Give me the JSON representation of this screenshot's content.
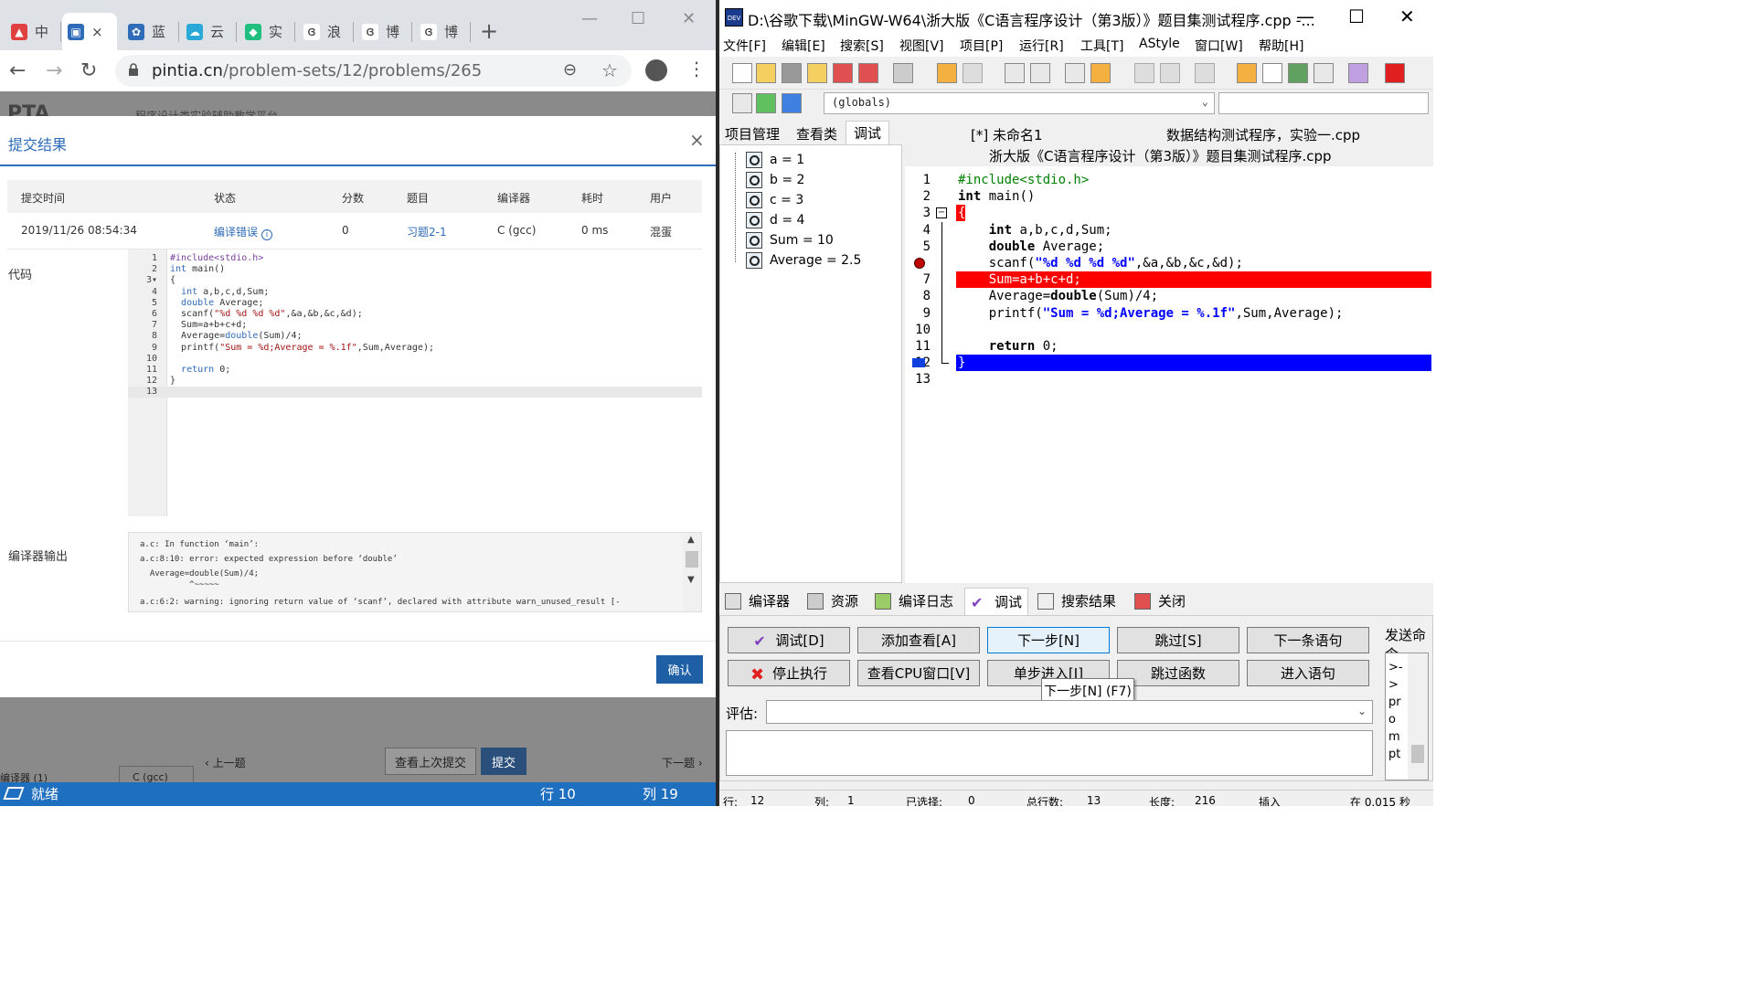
{
  "browser": {
    "tabs": [
      {
        "label": "中",
        "color": "#e04040"
      },
      {
        "label": "×",
        "color": "#2e6bb8"
      },
      {
        "label": "蓝",
        "color": "#2e6bb8"
      },
      {
        "label": "云",
        "color": "#2aa8d8"
      },
      {
        "label": "实",
        "color": "#1fbf7f"
      },
      {
        "label": "浪",
        "color": "#444444"
      },
      {
        "label": "博",
        "color": "#444444"
      },
      {
        "label": "博",
        "color": "#444444"
      }
    ],
    "new_tab": "+",
    "url_domain": "pintia.cn",
    "url_path": "/problem-sets/12/problems/265",
    "brand": "PTA",
    "site_name": "程序设计类实验辅助教学平台"
  },
  "modal": {
    "title": "提交结果",
    "close": "×",
    "headers": [
      "提交时间",
      "状态",
      "分数",
      "题目",
      "编译器",
      "耗时",
      "用户"
    ],
    "row": {
      "time": "2019/11/26 08:54:34",
      "status": "编译错误",
      "score": "0",
      "problem": "习题2-1",
      "compiler": "C (gcc)",
      "elapsed": "0 ms",
      "user": "混蛋"
    },
    "code_label": "代码",
    "code_lines": [
      "#include<stdio.h>",
      "int main()",
      "{",
      "  int a,b,c,d,Sum;",
      "  double Average;",
      "  scanf(\"%d %d %d %d\",&a,&b,&c,&d);",
      "  Sum=a+b+c+d;",
      "  Average=double(Sum)/4;",
      "  printf(\"Sum = %d;Average = %.1f\",Sum,Average);",
      "",
      "  return 0;",
      "}",
      ""
    ],
    "output_label": "编译器输出",
    "output_lines": [
      "a.c: In function ‘main’:",
      "a.c:8:10: error: expected expression before ‘double’",
      "  Average=double(Sum)/4;",
      "          ^~~~~~",
      "a.c:6:2: warning: ignoring return value of ‘scanf’, declared with attribute warn_unused_result [-"
    ],
    "confirm": "确认"
  },
  "page": {
    "prev": "上一题",
    "view_last": "查看上次提交",
    "submit": "提交",
    "next": "下一题",
    "compiler_label": "编译器 (1)",
    "compiler_value": "C (gcc)"
  },
  "status": {
    "ready": "就绪",
    "line": "行 10",
    "col": "列 19"
  },
  "devcpp": {
    "title": "D:\\谷歌下载\\MinGW-W64\\浙大版《C语言程序设计（第3版）》题目集测试程序.cpp -...",
    "menu": [
      "文件[F]",
      "编辑[E]",
      "搜索[S]",
      "视图[V]",
      "项目[P]",
      "运行[R]",
      "工具[T]",
      "AStyle",
      "窗口[W]",
      "帮助[H]"
    ],
    "globals": "(globals)",
    "left_tabs": [
      "项目管理",
      "查看类",
      "调试"
    ],
    "watches": [
      "a = 1",
      "b = 2",
      "c = 3",
      "d = 4",
      "Sum = 10",
      "Average = 2.5"
    ],
    "editor_tabs": [
      "[*] 未命名1",
      "数据结构测试程序，实验一.cpp",
      "浙大版《C语言程序设计（第3版）》题目集测试程序.cpp"
    ],
    "code_lines": [
      "#include<stdio.h>",
      "int main()",
      "{",
      "    int a,b,c,d,Sum;",
      "    double Average;",
      "    scanf(\"%d %d %d %d\",&a,&b,&c,&d);",
      "    Sum=a+b+c+d;",
      "    Average=double(Sum)/4;",
      "    printf(\"Sum = %d;Average = %.1f\",Sum,Average);",
      "",
      "    return 0;",
      "}",
      ""
    ],
    "bottom_tabs": [
      "编译器",
      "资源",
      "编译日志",
      "调试",
      "搜索结果",
      "关闭"
    ],
    "buttons": {
      "debug": "调试[D]",
      "add_watch": "添加查看[A]",
      "next_step": "下一步[N]",
      "skip": "跳过[S]",
      "next_stmt": "下一条语句",
      "stop": "停止执行",
      "cpu_window": "查看CPU窗口[V]",
      "step_into": "单步进入[I]",
      "skip_func": "跳过函数",
      "into_stmt": "进入语句"
    },
    "tooltip": "下一步[N] (F7)",
    "eval_label": "评估:",
    "send_label": "发送命令",
    "send_text": ">-\n>\npr\no\nm\npt",
    "status": [
      "行:",
      "12",
      "列:",
      "1",
      "已选择:",
      "0",
      "总行数:",
      "13",
      "长度:",
      "216",
      "插入",
      "在 0.015 秒"
    ]
  }
}
